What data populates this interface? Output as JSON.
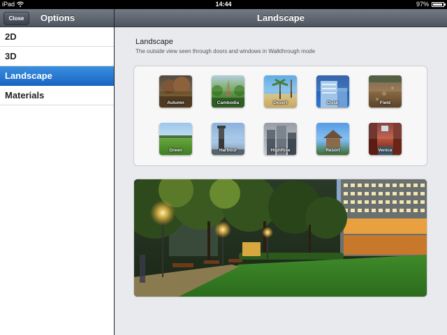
{
  "status_bar": {
    "carrier": "iPad",
    "time": "14:44",
    "battery": "97%"
  },
  "master": {
    "close_label": "Close",
    "title": "Options",
    "items": [
      {
        "label": "2D",
        "selected": false
      },
      {
        "label": "3D",
        "selected": false
      },
      {
        "label": "Landscape",
        "selected": true
      },
      {
        "label": "Materials",
        "selected": false
      }
    ]
  },
  "detail": {
    "title": "Landscape",
    "section_title": "Landscape",
    "section_description": "The outside view seen through doors and windows in Walkthrough mode",
    "thumbnails": [
      {
        "label": "Autumn"
      },
      {
        "label": "Cambodia"
      },
      {
        "label": "Desert"
      },
      {
        "label": "Dusk"
      },
      {
        "label": "Field"
      },
      {
        "label": "Green"
      },
      {
        "label": "Harbour"
      },
      {
        "label": "HighRise"
      },
      {
        "label": "Resort"
      },
      {
        "label": "Venice"
      }
    ]
  },
  "colors": {
    "selection_blue": "#1f6fcc",
    "nav_bar": "#5e6570"
  }
}
